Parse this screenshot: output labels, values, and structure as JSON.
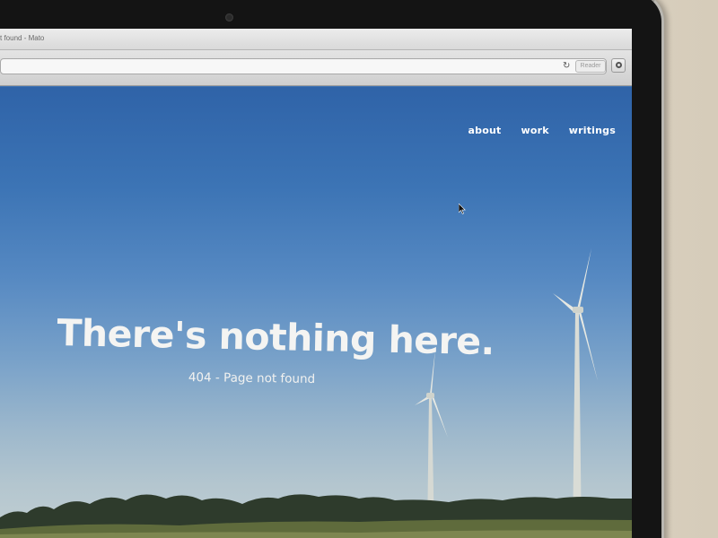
{
  "browser": {
    "tab_title": "t found - Mato",
    "reload_glyph": "↻",
    "reader_label": "Reader"
  },
  "nav": {
    "items": [
      {
        "label": "about"
      },
      {
        "label": "work"
      },
      {
        "label": "writings"
      }
    ]
  },
  "hero": {
    "headline": "There's nothing here.",
    "subtext": "404 - Page not found"
  },
  "colors": {
    "sky_top": "#2f63a8",
    "sky_bottom": "#c2cfd2",
    "bezel": "#141414",
    "text": "#f4f4f2"
  },
  "icons": [
    "reload-icon",
    "gear-icon",
    "cursor-icon",
    "camera-icon"
  ]
}
